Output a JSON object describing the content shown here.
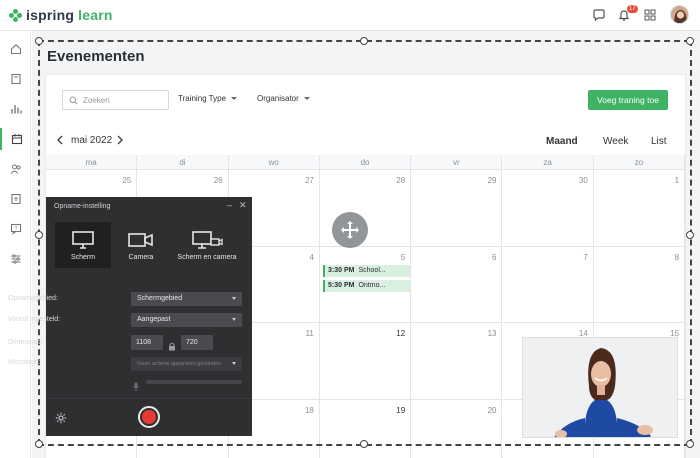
{
  "app": {
    "logo_prefix": "ispring",
    "logo_suffix": "learn",
    "notification_count": "17",
    "brand_color": "#3fb364"
  },
  "sidebar": {
    "items": [
      {
        "icon": "home-icon"
      },
      {
        "icon": "book-icon"
      },
      {
        "icon": "bar-chart-icon"
      },
      {
        "icon": "calendar-icon",
        "active": true
      },
      {
        "icon": "users-icon"
      },
      {
        "icon": "id-card-icon"
      },
      {
        "icon": "chat-question-icon"
      },
      {
        "icon": "sliders-icon"
      }
    ]
  },
  "page": {
    "title": "Evenementen"
  },
  "toolbar": {
    "search_placeholder": "Zoeken",
    "filter_training_type": "Training Type",
    "filter_organizer": "Organisator",
    "add_button": "Voeg traning toe"
  },
  "calendar": {
    "month_label": "mai 2022",
    "views": [
      "Maand",
      "Week",
      "List"
    ],
    "active_view": "Maand",
    "weekdays": [
      "ma",
      "di",
      "wo",
      "do",
      "vr",
      "za",
      "zo"
    ],
    "weeks": [
      [
        "",
        "26",
        "27",
        "28",
        "29",
        "30",
        "1"
      ],
      [
        "",
        "",
        "4",
        "5",
        "6",
        "7",
        "8"
      ],
      [
        "",
        "",
        "11",
        "12",
        "13",
        "14",
        "15"
      ],
      [
        "",
        "",
        "18",
        "19",
        "20",
        "",
        ""
      ]
    ],
    "week1_mon": "25",
    "events": [
      {
        "time": "3:30 PM",
        "title": "School..."
      },
      {
        "time": "5:30 PM",
        "title": "Ontmo..."
      }
    ]
  },
  "recorder": {
    "title": "Opname-instelling",
    "modes": [
      "Scherm",
      "Camera",
      "Scherm en camera"
    ],
    "active_mode": "Scherm",
    "rows": {
      "recording_area_label": "Opnamegebied:",
      "recording_area_value": "Schermgebied",
      "preset_label": "Vooraf ingesteld:",
      "preset_value": "Aangepast",
      "dimensions_label": "Dimensies:",
      "width": "1108",
      "height": "720",
      "microphone_label": "Microfoon:",
      "microphone_value": "Geen actieve apparaten gevonden"
    },
    "record_color": "#e53935"
  }
}
